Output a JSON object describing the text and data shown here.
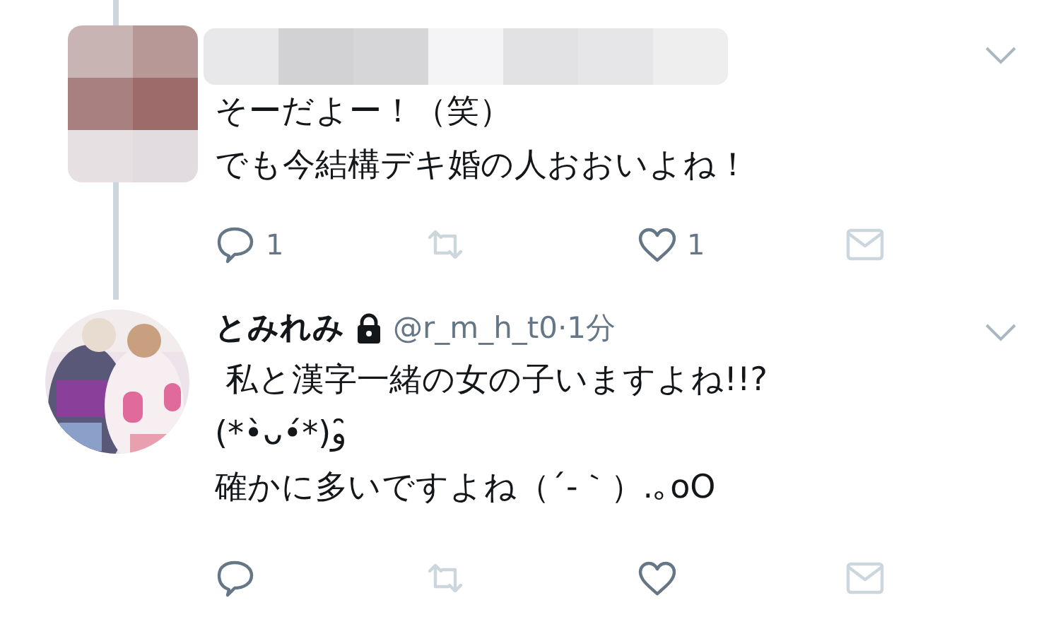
{
  "tweets": [
    {
      "redacted": true,
      "lines": [
        "そーだよー！（笑）",
        "でも今結構デキ婚の人おおいよね！"
      ],
      "actions": [
        {
          "kind": "reply",
          "count": "1"
        },
        {
          "kind": "retweet"
        },
        {
          "kind": "like",
          "count": "1"
        },
        {
          "kind": "message"
        }
      ]
    },
    {
      "redacted": false,
      "name": "とみれみ",
      "protected": true,
      "meta": "@r_m_h_t0·1分",
      "lines": [
        " 私と漢字一緒の女の子いますよね!!?",
        "(*•̀ᴗ•́*)و ̑̑",
        "確かに多いですよね（´-｀）.｡oO"
      ],
      "actions": [
        {
          "kind": "reply"
        },
        {
          "kind": "retweet"
        },
        {
          "kind": "like"
        },
        {
          "kind": "message"
        }
      ]
    }
  ]
}
